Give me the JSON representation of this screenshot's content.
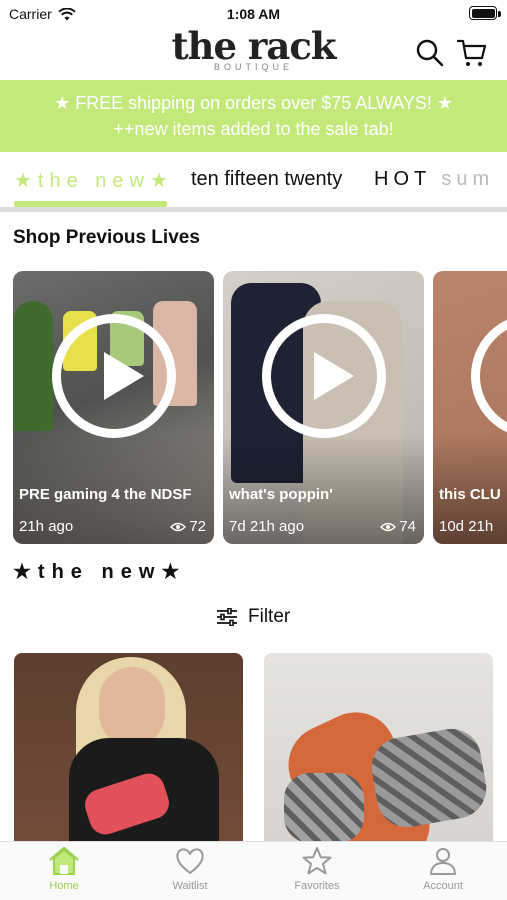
{
  "status_bar": {
    "carrier": "Carrier",
    "time": "1:08 AM"
  },
  "header": {
    "logo_main": "the rack",
    "logo_sub": "BOUTIQUE"
  },
  "banner": {
    "line1": "★ FREE shipping on orders over $75 ALWAYS! ★",
    "line2": "++new items added to the sale tab!"
  },
  "tabs": [
    {
      "label": "★the new★"
    },
    {
      "label": "ten fifteen twenty"
    },
    {
      "label": "HOT sum"
    }
  ],
  "lives_section": {
    "title": "Shop Previous Lives",
    "cards": [
      {
        "title": "PRE gaming 4 the NDSF",
        "time": "21h ago",
        "views": "72"
      },
      {
        "title": "what's poppin'",
        "time": "7d 21h ago",
        "views": "74"
      },
      {
        "title": "this CLU",
        "time": "10d 21h",
        "views": ""
      }
    ]
  },
  "products_section": {
    "title": "★the new★",
    "filter_label": "Filter"
  },
  "tabbar": [
    {
      "label": "Home",
      "icon": "home-icon"
    },
    {
      "label": "Waitlist",
      "icon": "heart-icon"
    },
    {
      "label": "Favorites",
      "icon": "star-icon"
    },
    {
      "label": "Account",
      "icon": "person-icon"
    }
  ],
  "colors": {
    "accent": "#c3e97a",
    "tab_active": "#9ad14f",
    "banner_text": "#ffffff"
  }
}
